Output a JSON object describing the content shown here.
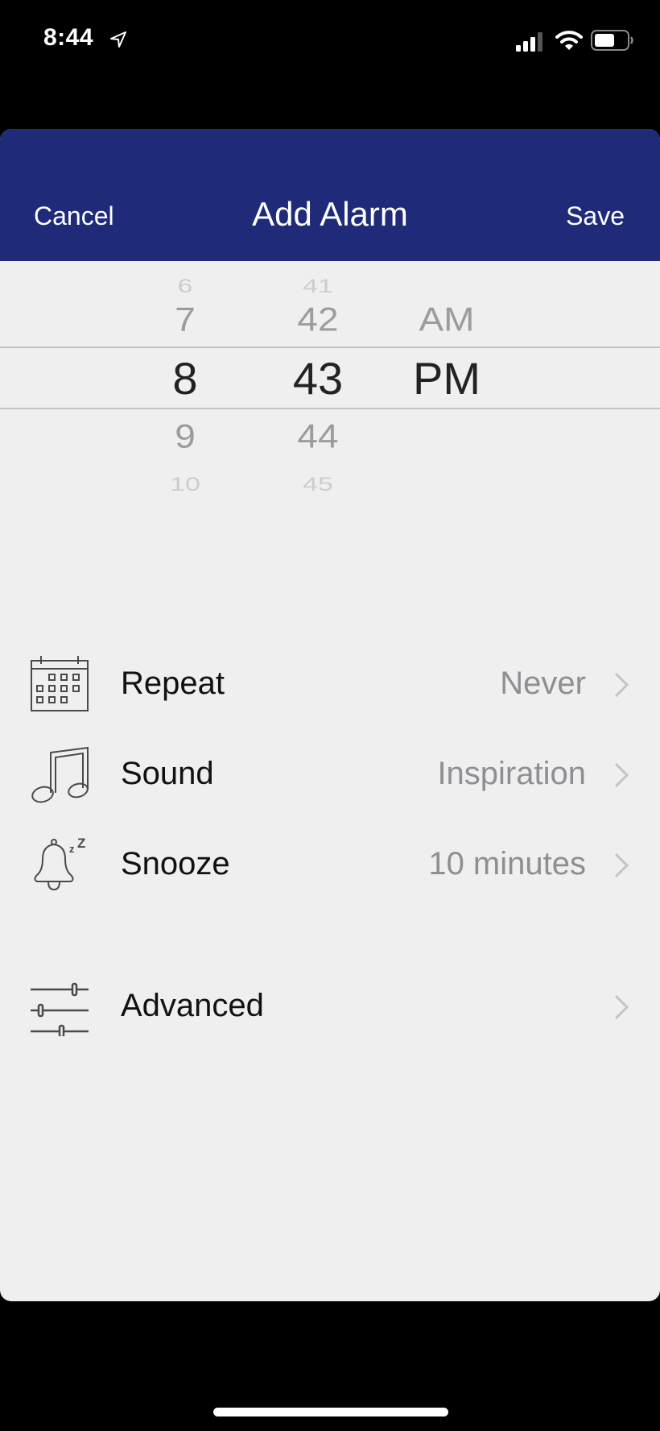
{
  "status_bar": {
    "time": "8:44",
    "icons": [
      "location-arrow-icon",
      "cellular-signal-icon",
      "wifi-icon",
      "battery-icon"
    ]
  },
  "navbar": {
    "cancel_label": "Cancel",
    "title": "Add Alarm",
    "save_label": "Save",
    "background_color": "#1f2a78"
  },
  "time_picker": {
    "hours": {
      "values": [
        "6",
        "7",
        "8",
        "9",
        "10"
      ],
      "selected": "8"
    },
    "minutes": {
      "values": [
        "41",
        "42",
        "43",
        "44",
        "45"
      ],
      "selected": "43"
    },
    "period": {
      "values": [
        "AM",
        "PM"
      ],
      "selected": "PM"
    }
  },
  "settings": [
    {
      "icon": "calendar-icon",
      "label": "Repeat",
      "value": "Never"
    },
    {
      "icon": "music-note-icon",
      "label": "Sound",
      "value": "Inspiration"
    },
    {
      "icon": "snooze-bell-icon",
      "label": "Snooze",
      "value": "10 minutes"
    }
  ],
  "advanced": {
    "icon": "sliders-icon",
    "label": "Advanced",
    "value": ""
  }
}
